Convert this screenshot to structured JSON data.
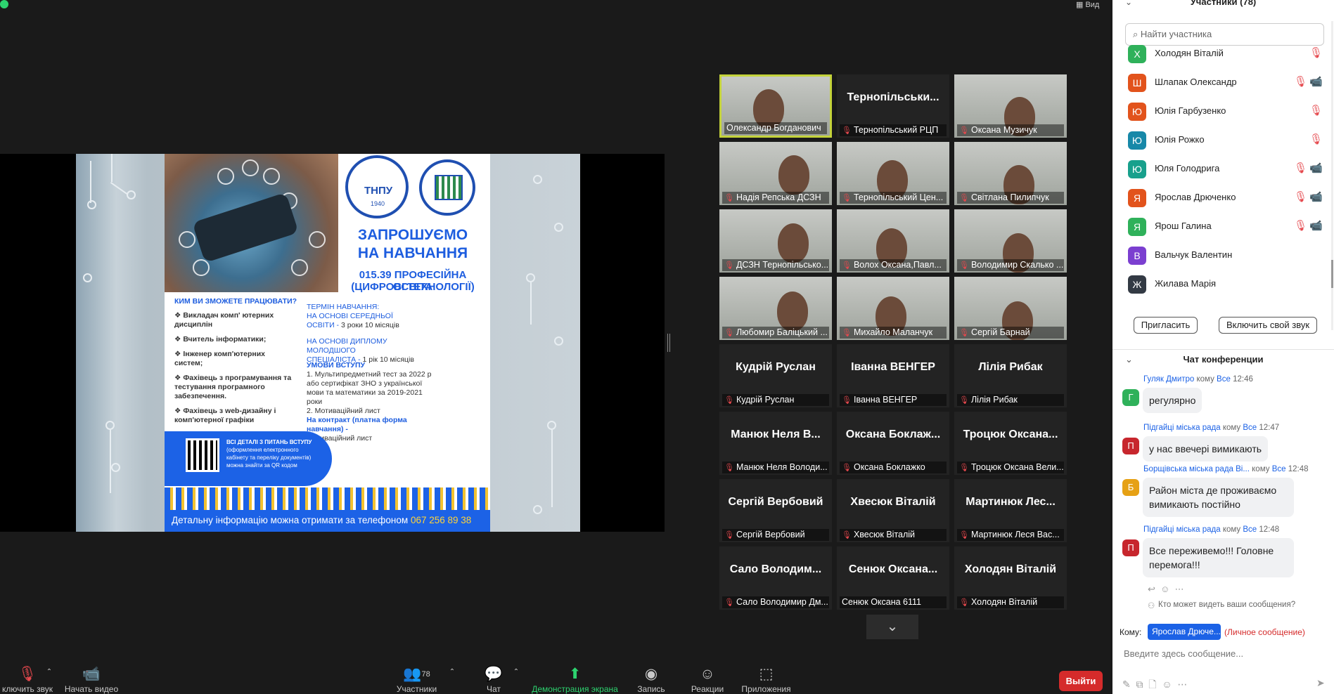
{
  "top": {
    "view_label": "Вид"
  },
  "slide": {
    "heading1": "ЗАПРОШУЄМО",
    "heading2": "НА НАВЧАННЯ",
    "program1": "015.39 ПРОФЕСІЙНА ОСВІТА",
    "program2": "(ЦИФРОВІ ТЕХНОЛОГІЇ)",
    "logo_text": "ТНПУ",
    "logo_year": "1940",
    "question": "КИМ ВИ ЗМОЖЕТЕ ПРАЦЮВАТИ?",
    "jobs": [
      "Викладач комп' ютерних дисциплін",
      "Вчитель інформатики;",
      "Інженер комп'ютерних систем;",
      "Фахівець з програмування та тестування програмного забезпечення.",
      "Фахівець з web-дизайну і комп'ютерної графіки"
    ],
    "term_title": "ТЕРМІН НАВЧАННЯ:",
    "term_line1": "НА ОСНОВІ СЕРЕДНЬОЇ",
    "term_line2": "ОСВІТИ -",
    "term_line2b": "3 роки 10 місяців",
    "term_line3": "НА ОСНОВІ ДИПЛОМУ МОЛОДШОГО",
    "term_line4": "СПЕЦІАЛІСТА -",
    "term_line4b": "1 рік 10 місяців",
    "cond_title": "УМОВИ ВСТУПУ",
    "cond1": "1. Мультипредметний тест за 2022 р або сертифікат ЗНО з української мови та математики за 2019-2021 роки",
    "cond2": "2. Мотиваційний лист",
    "cond3": "На контракт (платна форма навчання) -",
    "cond4": "Мотиваційний лист",
    "qr_title": "ВСІ ДЕТАЛІ З ПИТАНЬ ВСТУПУ",
    "qr_line1": "(оформлення електронного",
    "qr_line2": "кабінету та переліку документів)",
    "qr_line3": "можна знайти за QR кодом",
    "footer": "Детальну інформацію можна отримати за телефоном",
    "phone": "067 256 89 38"
  },
  "tiles": [
    {
      "name": "Олександр Богданович",
      "big": "",
      "video": true,
      "muted": false,
      "active": true
    },
    {
      "name": "Тернопільський РЦП",
      "big": "Тернопільськи...",
      "video": false,
      "muted": true
    },
    {
      "name": "Оксана Музичук",
      "big": "",
      "video": true,
      "muted": true
    },
    {
      "name": "Надія Репська ДСЗН",
      "big": "",
      "video": true,
      "muted": true
    },
    {
      "name": "Тернопільський Цен...",
      "big": "",
      "video": true,
      "muted": true
    },
    {
      "name": "Світлана Пилипчук",
      "big": "",
      "video": true,
      "muted": true
    },
    {
      "name": "ДСЗН Тернопільсько...",
      "big": "",
      "video": true,
      "muted": true
    },
    {
      "name": "Волох Оксана,Павл...",
      "big": "",
      "video": true,
      "muted": true
    },
    {
      "name": "Володимир Скалько ...",
      "big": "",
      "video": true,
      "muted": true
    },
    {
      "name": "Любомир Баліцький ...",
      "big": "",
      "video": true,
      "muted": true
    },
    {
      "name": "Михайло Маланчук",
      "big": "",
      "video": true,
      "muted": true
    },
    {
      "name": "Сергій Барнай",
      "big": "",
      "video": true,
      "muted": true
    },
    {
      "name": "Кудрій Руслан",
      "big": "Кудрій Руслан",
      "video": false,
      "muted": true
    },
    {
      "name": "Іванна ВЕНГЕР",
      "big": "Іванна ВЕНГЕР",
      "video": false,
      "muted": true
    },
    {
      "name": "Лілія Рибак",
      "big": "Лілія Рибак",
      "video": false,
      "muted": true
    },
    {
      "name": "Манюк Неля Володи...",
      "big": "Манюк Неля В...",
      "video": false,
      "muted": true
    },
    {
      "name": "Оксана Боклажко",
      "big": "Оксана Боклаж...",
      "video": false,
      "muted": true
    },
    {
      "name": "Троцюк Оксана Вели...",
      "big": "Троцюк Оксана...",
      "video": false,
      "muted": true
    },
    {
      "name": "Сергій Вербовий",
      "big": "Сергій Вербовий",
      "video": false,
      "muted": true
    },
    {
      "name": "Хвесюк Віталій",
      "big": "Хвесюк Віталій",
      "video": false,
      "muted": true
    },
    {
      "name": "Мартинюк Леся Вас...",
      "big": "Мартинюк Лес...",
      "video": false,
      "muted": true
    },
    {
      "name": "Сало Володимир Дм...",
      "big": "Сало Володим...",
      "video": false,
      "muted": true
    },
    {
      "name": "Сенюк Оксана 6111",
      "big": "Сенюк Оксана...",
      "video": false,
      "muted": false
    },
    {
      "name": "Холодян Віталій",
      "big": "Холодян Віталій",
      "video": false,
      "muted": true
    }
  ],
  "toolbar": {
    "mute": "ключить звук",
    "video": "Начать видео",
    "participants": "Участники",
    "participants_count": "78",
    "chat": "Чат",
    "share": "Демонстрация экрана",
    "record": "Запись",
    "reactions": "Реакции",
    "apps": "Приложения",
    "leave": "Выйти"
  },
  "side": {
    "title": "Участники (78)",
    "search_placeholder": "Найти участника",
    "participants": [
      {
        "initial": "Х",
        "name": "Холодян Віталій",
        "color": "#2fb15a",
        "video_off": false
      },
      {
        "initial": "Ш",
        "name": "Шлапак Олександр",
        "color": "#e2531c",
        "video_off": true
      },
      {
        "initial": "Ю",
        "name": "Юлія Гарбузенко",
        "color": "#e2531c",
        "video_off": false
      },
      {
        "initial": "Ю",
        "name": "Юлія Рожко",
        "color": "#1788a8",
        "video_off": false
      },
      {
        "initial": "Ю",
        "name": "Юля Голодрига",
        "color": "#18a08c",
        "video_off": true
      },
      {
        "initial": "Я",
        "name": "Ярослав Дрюченко",
        "color": "#e2531c",
        "video_off": true
      },
      {
        "initial": "Я",
        "name": "Ярош Галина",
        "color": "#2fb15a",
        "video_off": true
      },
      {
        "initial": "В",
        "name": "Вальчук Валентин",
        "color": "#7b3fd0",
        "video_off": false
      },
      {
        "initial": "Ж",
        "name": "Жилава Марія",
        "color": "#333a44",
        "video_off": false
      }
    ],
    "invite": "Пригласить",
    "unmute": "Включить свой звук",
    "chat_title": "Чат конференции",
    "messages": [
      {
        "initial": "Г",
        "color": "#2fb15a",
        "from": "Гуляк Дмитро",
        "to_word": "кому",
        "to": "Все",
        "time": "12:46",
        "text": "регулярно"
      },
      {
        "initial": "П",
        "color": "#c7262d",
        "from": "Підгайці міська рада",
        "to_word": "кому",
        "to": "Все",
        "time": "12:47",
        "text": "у нас ввечері вимикають"
      },
      {
        "initial": "Б",
        "color": "#e6a115",
        "from": "Борщівська міська рада Ві...",
        "to_word": "кому",
        "to": "Все",
        "time": "12:48",
        "text": "Район міста де проживаємо вимикають постійно"
      },
      {
        "initial": "П",
        "color": "#c7262d",
        "from": "Підгайці міська рада",
        "to_word": "кому",
        "to": "Все",
        "time": "12:48",
        "text": "Все переживемо!!! Головне перемога!!!"
      }
    ],
    "who_can_see": "Кто может видеть ваши сообщения?",
    "to_label": "Кому:",
    "to_value": "Ярослав Дрюче...",
    "private": "(Личное сообщение)",
    "input_placeholder": "Введите здесь сообщение..."
  }
}
